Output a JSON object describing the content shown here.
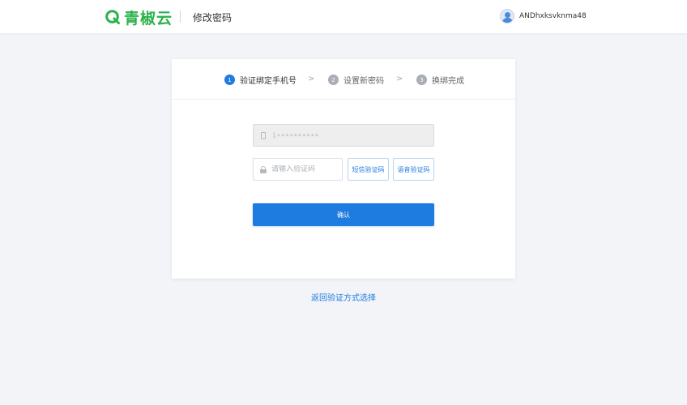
{
  "header": {
    "logo_text": "青椒云",
    "page_title": "修改密码",
    "username": "ANDhxksvknma48",
    "brand_color": "#2bb24c"
  },
  "steps": [
    {
      "number": "1",
      "label": "验证绑定手机号",
      "active": true
    },
    {
      "number": "2",
      "label": "设置新密码",
      "active": false
    },
    {
      "number": "3",
      "label": "换绑完成",
      "active": false
    }
  ],
  "step_separator": ">",
  "form": {
    "phone_value": "1••••••••••",
    "code_placeholder": "请输入验证码",
    "sms_button": "短信验证码",
    "voice_button": "语音验证码",
    "confirm_button": "确认"
  },
  "back_link": "返回验证方式选择",
  "accent_color": "#1e7be0"
}
